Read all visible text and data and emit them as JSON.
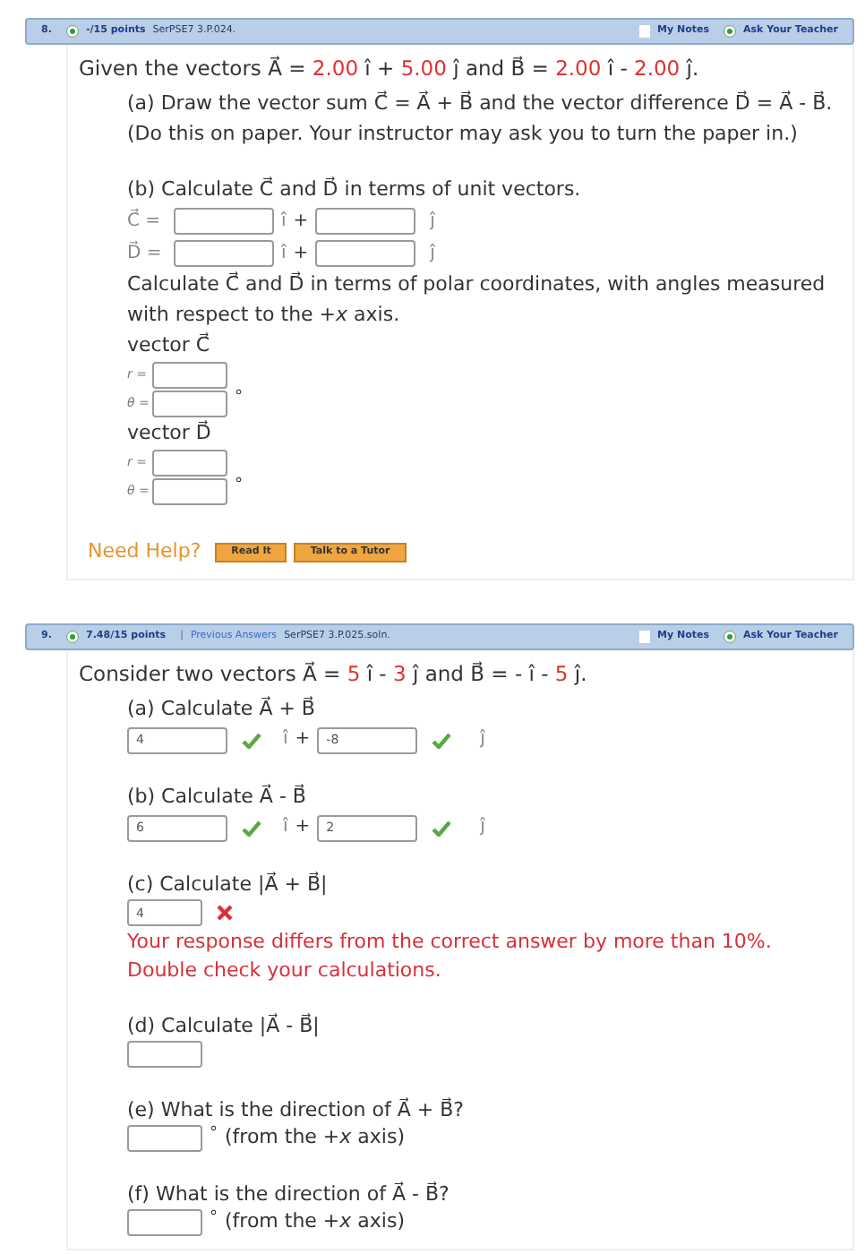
{
  "questions": [
    {
      "number": "8.",
      "points": "-/15 points",
      "code": "SerPSE7 3.P.024.",
      "my_notes": "My Notes",
      "ask": "Ask Your Teacher",
      "intro": [
        {
          "kind": "plain",
          "text": "Given the vectors A⃗ = "
        },
        {
          "kind": "value",
          "text": "2.00"
        },
        {
          "kind": "plain",
          "text": " î + "
        },
        {
          "kind": "value",
          "text": "5.00"
        },
        {
          "kind": "plain",
          "text": " ĵ and B⃗ = "
        },
        {
          "kind": "value",
          "text": "2.00"
        },
        {
          "kind": "plain",
          "text": " î - "
        },
        {
          "kind": "value",
          "text": "2.00"
        },
        {
          "kind": "plain",
          "text": " ĵ."
        }
      ],
      "parts": [
        [
          {
            "kind": "text",
            "text": "(a) Draw the vector sum C⃗ = A⃗ + B⃗ and the vector difference D⃗ = A⃗ - B⃗."
          },
          {
            "kind": "text",
            "text": "(Do this on paper. Your instructor may ask you to turn the paper in.)"
          }
        ],
        [
          {
            "kind": "text",
            "text": "(b) Calculate C⃗ and D⃗ in terms of unit vectors."
          },
          {
            "kind": "unit_vector",
            "label": "C⃗ =",
            "i_unit": "î",
            "plus": "+",
            "j_unit": "ĵ"
          },
          {
            "kind": "unit_vector",
            "label": "D⃗ =",
            "i_unit": "î",
            "plus": "+",
            "j_unit": "ĵ"
          },
          {
            "kind": "text",
            "text": "Calculate C⃗ and D⃗ in terms of polar coordinates, with angles measured with respect to the +*x* axis."
          },
          {
            "kind": "text",
            "text": "vector C⃗"
          },
          {
            "kind": "answer",
            "label": "r ="
          },
          {
            "kind": "answer",
            "label": "θ =",
            "unit": "°"
          },
          {
            "kind": "text",
            "text": "vector D⃗"
          },
          {
            "kind": "answer",
            "label": "r ="
          },
          {
            "kind": "answer",
            "label": "θ =",
            "unit": "°"
          }
        ],
        [
          {
            "kind": "help",
            "text": "Need Help?",
            "buttons": [
              "Read It",
              "Talk to a Tutor"
            ]
          }
        ]
      ]
    },
    {
      "number": "9.",
      "points": "7.48/15 points",
      "separator": "|",
      "previous": "Previous Answers",
      "code": "SerPSE7 3.P.025.soln.",
      "my_notes": "My Notes",
      "ask": "Ask Your Teacher",
      "intro": [
        {
          "kind": "plain",
          "text": "Consider two vectors A⃗ = "
        },
        {
          "kind": "value",
          "text": "5"
        },
        {
          "kind": "plain",
          "text": " î - "
        },
        {
          "kind": "value",
          "text": "3"
        },
        {
          "kind": "plain",
          "text": " ĵ and B⃗ = - î - "
        },
        {
          "kind": "value",
          "text": "5"
        },
        {
          "kind": "plain",
          "text": " ĵ."
        }
      ],
      "parts": [
        [
          {
            "kind": "text",
            "text": "(a) Calculate A⃗ + B⃗"
          },
          {
            "kind": "unit_vector",
            "i_answer": "4",
            "i_correct": true,
            "i_unit": "î",
            "plus": "+",
            "j_answer": "-8",
            "j_correct": true,
            "j_unit": "ĵ"
          }
        ],
        [
          {
            "kind": "text",
            "text": "(b) Calculate A⃗ - B⃗"
          },
          {
            "kind": "unit_vector",
            "i_answer": "6",
            "i_correct": true,
            "i_unit": "î",
            "plus": "+",
            "j_answer": "2",
            "j_correct": true,
            "j_unit": "ĵ"
          }
        ],
        [
          {
            "kind": "text",
            "text": "(c) Calculate |A⃗ + B⃗|"
          },
          {
            "kind": "answer",
            "answer": "4",
            "correct": false
          },
          {
            "kind": "feedback",
            "text": "Your response differs from the correct answer by more than 10%."
          },
          {
            "kind": "feedback",
            "text": "Double check your calculations."
          }
        ],
        [
          {
            "kind": "text",
            "text": "(d) Calculate |A⃗ - B⃗|"
          },
          {
            "kind": "answer"
          }
        ],
        [
          {
            "kind": "text",
            "text": "(e) What is the direction of A⃗ + B⃗?"
          },
          {
            "kind": "answer",
            "unit": "°",
            "suffix": "(from the +*x* axis)"
          }
        ],
        [
          {
            "kind": "text",
            "text": "(f) What is the direction of A⃗ - B⃗?"
          },
          {
            "kind": "answer",
            "unit": "°",
            "suffix": "(from the +*x* axis)"
          }
        ]
      ]
    }
  ]
}
